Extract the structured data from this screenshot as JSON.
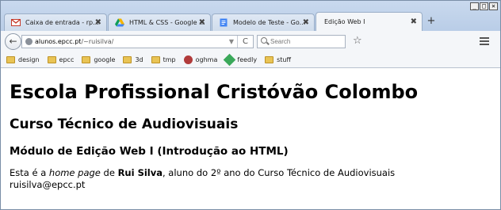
{
  "tabs": [
    {
      "label": "Caixa de entrada - rp...",
      "icon": "gmail-icon",
      "active": false
    },
    {
      "label": "HTML & CSS - Google ...",
      "icon": "google-drive-icon",
      "active": false
    },
    {
      "label": "Modelo de Teste - Go...",
      "icon": "google-docs-icon",
      "active": false
    },
    {
      "label": "Edição Web I",
      "icon": "",
      "active": true
    }
  ],
  "tab_close_glyph": "✖",
  "new_tab_glyph": "+",
  "window_controls": [
    "_",
    "□",
    "✕"
  ],
  "navbar": {
    "back_glyph": "←",
    "url_host": "alunos.epcc.pt",
    "url_path": "/~ruisilva/",
    "dropdown_glyph": "▼",
    "reload_glyph": "C",
    "search_placeholder": "Search",
    "star_glyph": "☆"
  },
  "bookmarks": [
    {
      "label": "design",
      "icon": "folder-icon"
    },
    {
      "label": "epcc",
      "icon": "folder-icon"
    },
    {
      "label": "google",
      "icon": "folder-icon"
    },
    {
      "label": "3d",
      "icon": "folder-icon"
    },
    {
      "label": "tmp",
      "icon": "folder-icon"
    },
    {
      "label": "oghma",
      "icon": "oghma-icon"
    },
    {
      "label": "feedly",
      "icon": "feedly-icon"
    },
    {
      "label": "stuff",
      "icon": "folder-icon"
    }
  ],
  "page": {
    "h1": "Escola Profissional Cristóvão Colombo",
    "h2": "Curso Técnico de Audiovisuais",
    "h3": "Módulo de Edição Web I (Introdução ao HTML)",
    "p_pre": "Esta é a ",
    "p_em": "home page",
    "p_mid": " de ",
    "p_strong": "Rui Silva",
    "p_post": ", aluno do 2º ano do Curso Técnico de Audiovisuais",
    "email": "ruisilva@epcc.pt"
  }
}
